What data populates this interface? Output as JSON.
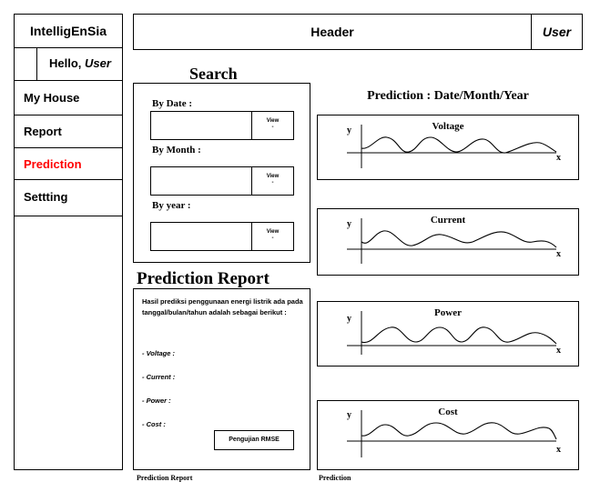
{
  "sidebar": {
    "app_name": "IntelligEnSia",
    "greeting_prefix": "Hello, ",
    "greeting_user": "User",
    "items": [
      {
        "label": "My House",
        "active": false
      },
      {
        "label": "Report",
        "active": false
      },
      {
        "label": "Prediction",
        "active": true
      },
      {
        "label": "Settting",
        "active": false
      }
    ]
  },
  "header": {
    "title": "Header",
    "user": "User"
  },
  "search": {
    "title": "Search",
    "by_date_label": "By Date :",
    "by_month_label": "By Month :",
    "by_year_label": "By year :",
    "view_label": "View",
    "view_dash": "-"
  },
  "report": {
    "title": "Prediction Report",
    "text": "Hasil prediksi penggunaan energi listrik ada pada tanggal/bulan/tahun adalah sebagai berikut :",
    "items": [
      "- Voltage :",
      "- Current :",
      "- Power :",
      "- Cost :"
    ],
    "rmse_button": "Pengujian RMSE"
  },
  "prediction": {
    "title": "Prediction : Date/Month/Year",
    "axis_x": "x",
    "axis_y": "y",
    "charts": [
      {
        "title": "Voltage"
      },
      {
        "title": "Current"
      },
      {
        "title": "Power"
      },
      {
        "title": "Cost"
      }
    ]
  },
  "captions": {
    "left": "Prediction Report",
    "right": "Prediction"
  },
  "colors": {
    "active_nav": "#ff0000",
    "border": "#000000"
  }
}
